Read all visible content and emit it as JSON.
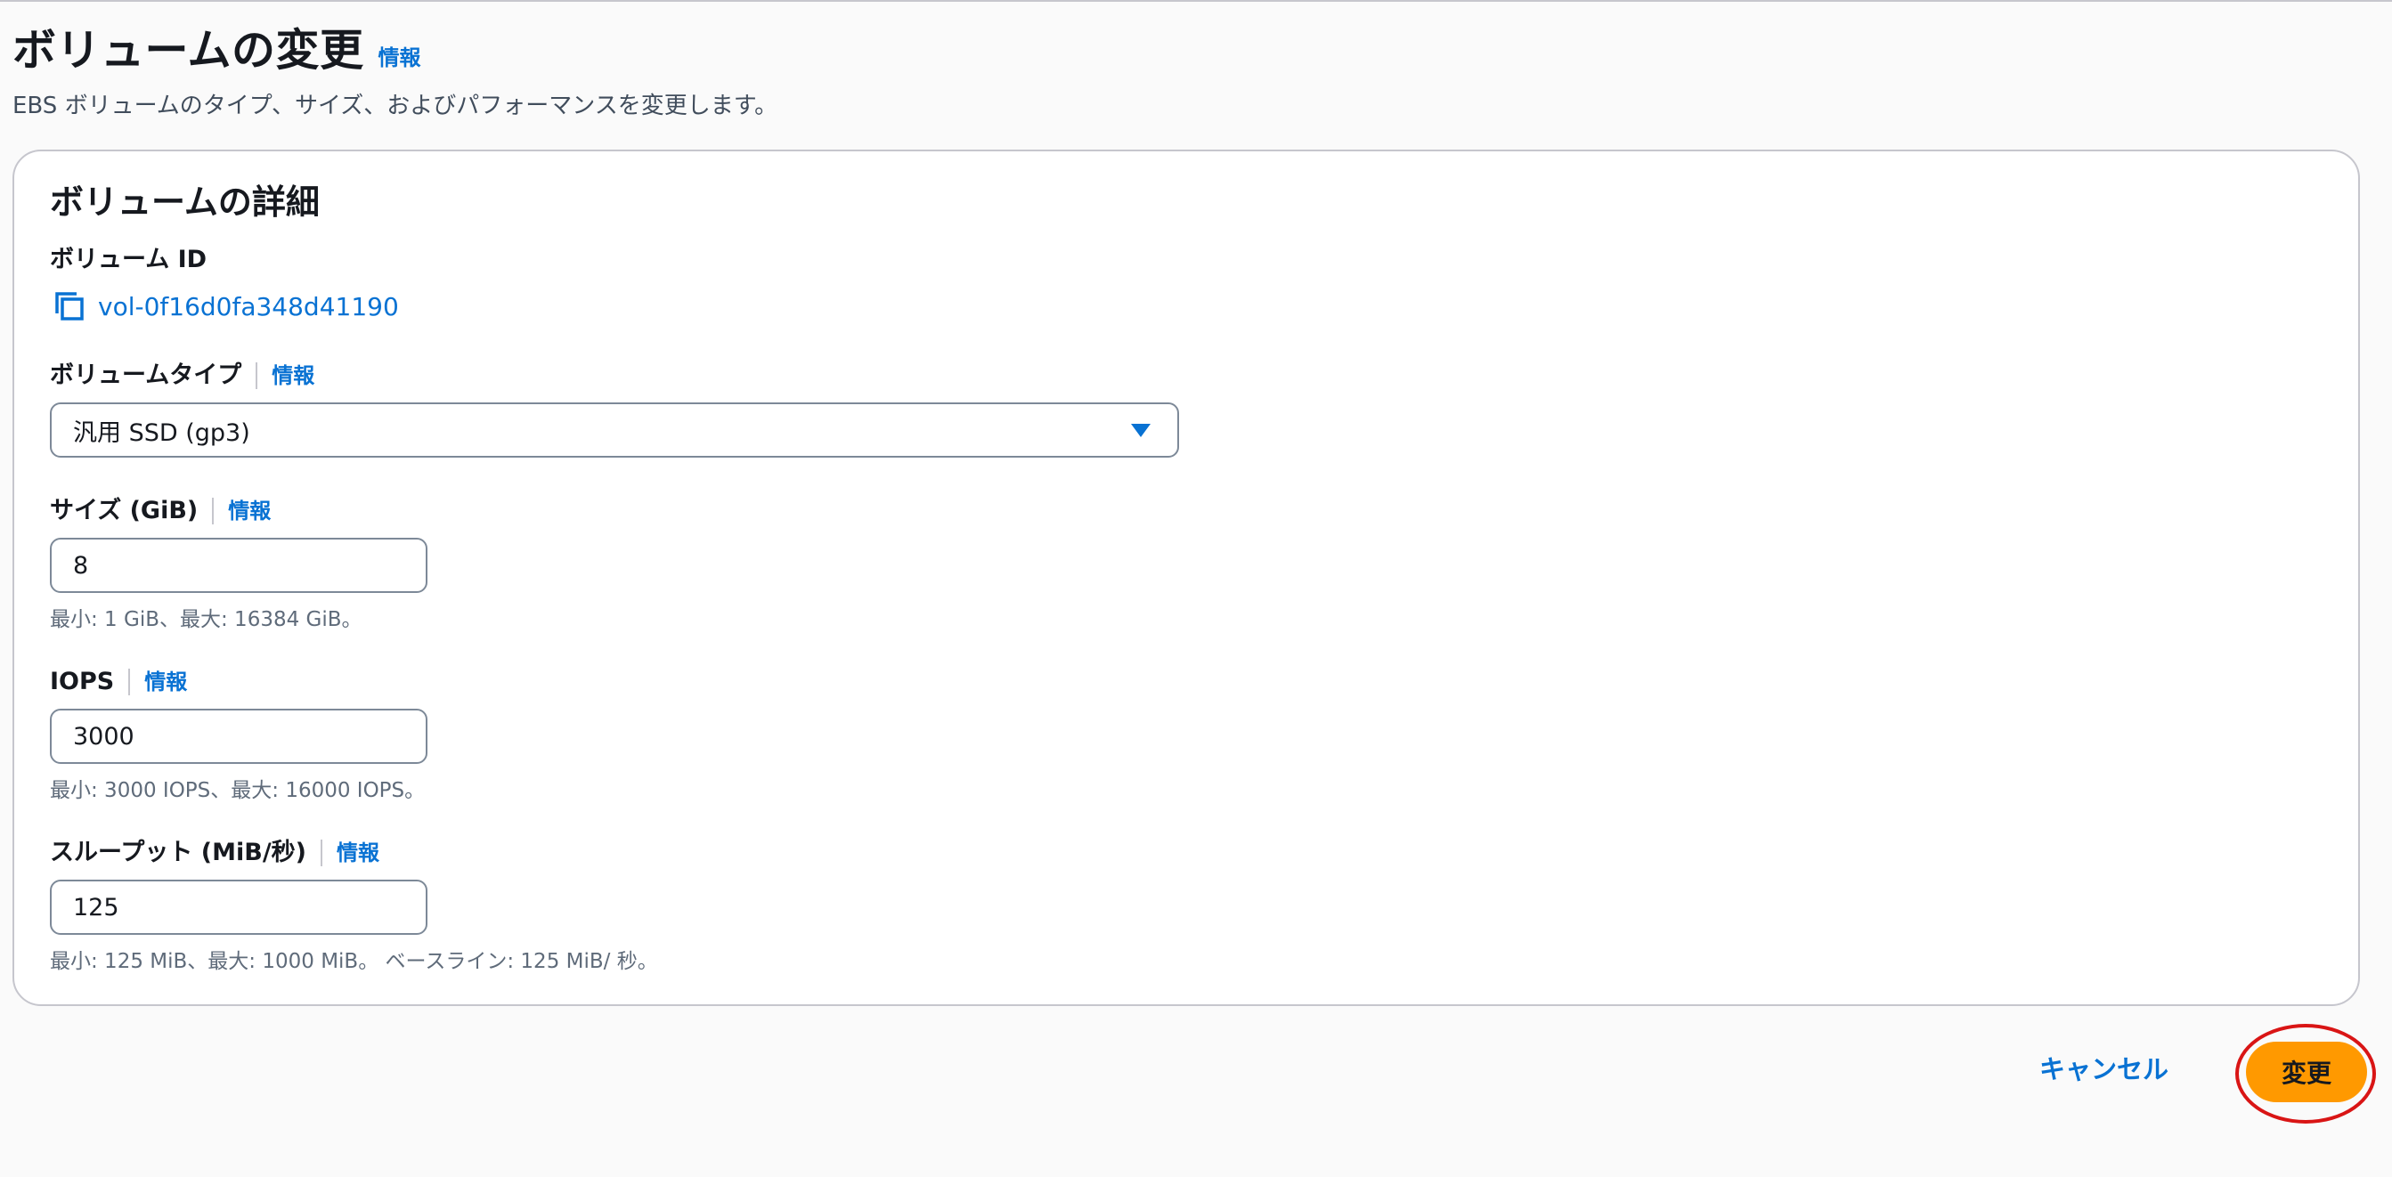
{
  "header": {
    "title": "ボリュームの変更",
    "info": "情報",
    "description": "EBS ボリュームのタイプ、サイズ、およびパフォーマンスを変更します。"
  },
  "panel": {
    "title": "ボリュームの詳細",
    "volume_id": {
      "label": "ボリューム ID",
      "value": "vol-0f16d0fa348d41190"
    },
    "volume_type": {
      "label": "ボリュームタイプ",
      "info": "情報",
      "selected": "汎用 SSD (gp3)"
    },
    "size": {
      "label": "サイズ (GiB)",
      "info": "情報",
      "value": "8",
      "hint": "最小: 1 GiB、最大: 16384 GiB。"
    },
    "iops": {
      "label": "IOPS",
      "info": "情報",
      "value": "3000",
      "hint": "最小: 3000 IOPS、最大: 16000 IOPS。"
    },
    "throughput": {
      "label": "スループット (MiB/秒)",
      "info": "情報",
      "value": "125",
      "hint": "最小: 125 MiB、最大: 1000 MiB。 ベースライン: 125 MiB/ 秒。"
    }
  },
  "actions": {
    "cancel": "キャンセル",
    "submit": "変更"
  },
  "colors": {
    "link": "#0972d3",
    "primary_button": "#ff9900",
    "highlight": "#d91515"
  },
  "icons": {
    "copy": "copy-icon",
    "dropdown": "caret-down-icon"
  }
}
